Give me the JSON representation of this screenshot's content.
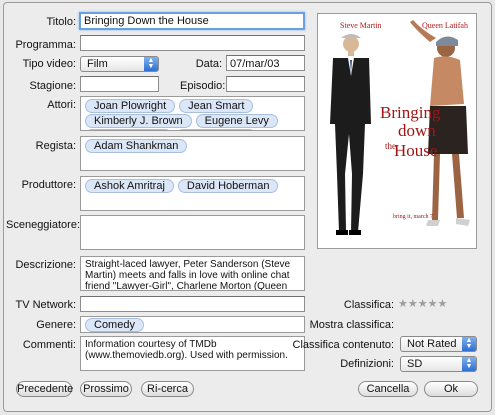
{
  "labels": {
    "titolo": "Titolo:",
    "programma": "Programma:",
    "tipo_video": "Tipo video:",
    "data": "Data:",
    "stagione": "Stagione:",
    "episodio": "Episodio:",
    "attori": "Attori:",
    "regista": "Regista:",
    "produttore": "Produttore:",
    "sceneggiatore": "Sceneggiatore:",
    "descrizione": "Descrizione:",
    "tv_network": "TV Network:",
    "genere": "Genere:",
    "commenti": "Commenti:",
    "classifica": "Classifica:",
    "mostra_classifica": "Mostra classifica:",
    "classifica_contenuto": "Classifica contenuto:",
    "definizioni": "Definizioni:"
  },
  "fields": {
    "titolo": "Bringing Down the House",
    "programma": "",
    "tipo_video": "Film",
    "data": "07/mar/03",
    "stagione": "",
    "episodio": "",
    "tv_network": "",
    "descrizione": "Straight-laced lawyer, Peter Sanderson (Steve Martin) meets and falls in love with online chat friend \"Lawyer-Girl\", Charlene Morton (Queen Latifah), only",
    "commenti": "Information courtesy of TMDb (www.themoviedb.org). Used with permission.",
    "classifica_contenuto": "Not Rated",
    "definizioni": "SD"
  },
  "attori": [
    "Joan Plowright",
    "Jean Smart",
    "Kimberly J. Brown",
    "Eugene Levy",
    "Queen Latifah",
    "Steve Martin"
  ],
  "regista": [
    "Adam Shankman"
  ],
  "produttore": [
    "Ashok Amritraj",
    "David Hoberman"
  ],
  "sceneggiatore": [],
  "genere": [
    "Comedy"
  ],
  "rating": {
    "stars_filled": 0,
    "stars_total": 5,
    "symbol": "★★★★★"
  },
  "poster": {
    "actor_left": "Steve Martin",
    "actor_right": "Queen Latifah",
    "title_lines": [
      "Bringing",
      "down",
      "the",
      "House"
    ],
    "tagline": "bring it, march 7"
  },
  "buttons": {
    "precedente": "Precedente",
    "prossimo": "Prossimo",
    "ricerca": "Ri-cerca",
    "cancella": "Cancella",
    "ok": "Ok"
  },
  "colors": {
    "focus": "#6a9fe0",
    "tag_bg": "#dbe6f7",
    "select_arrows": "#2f6fd0"
  }
}
